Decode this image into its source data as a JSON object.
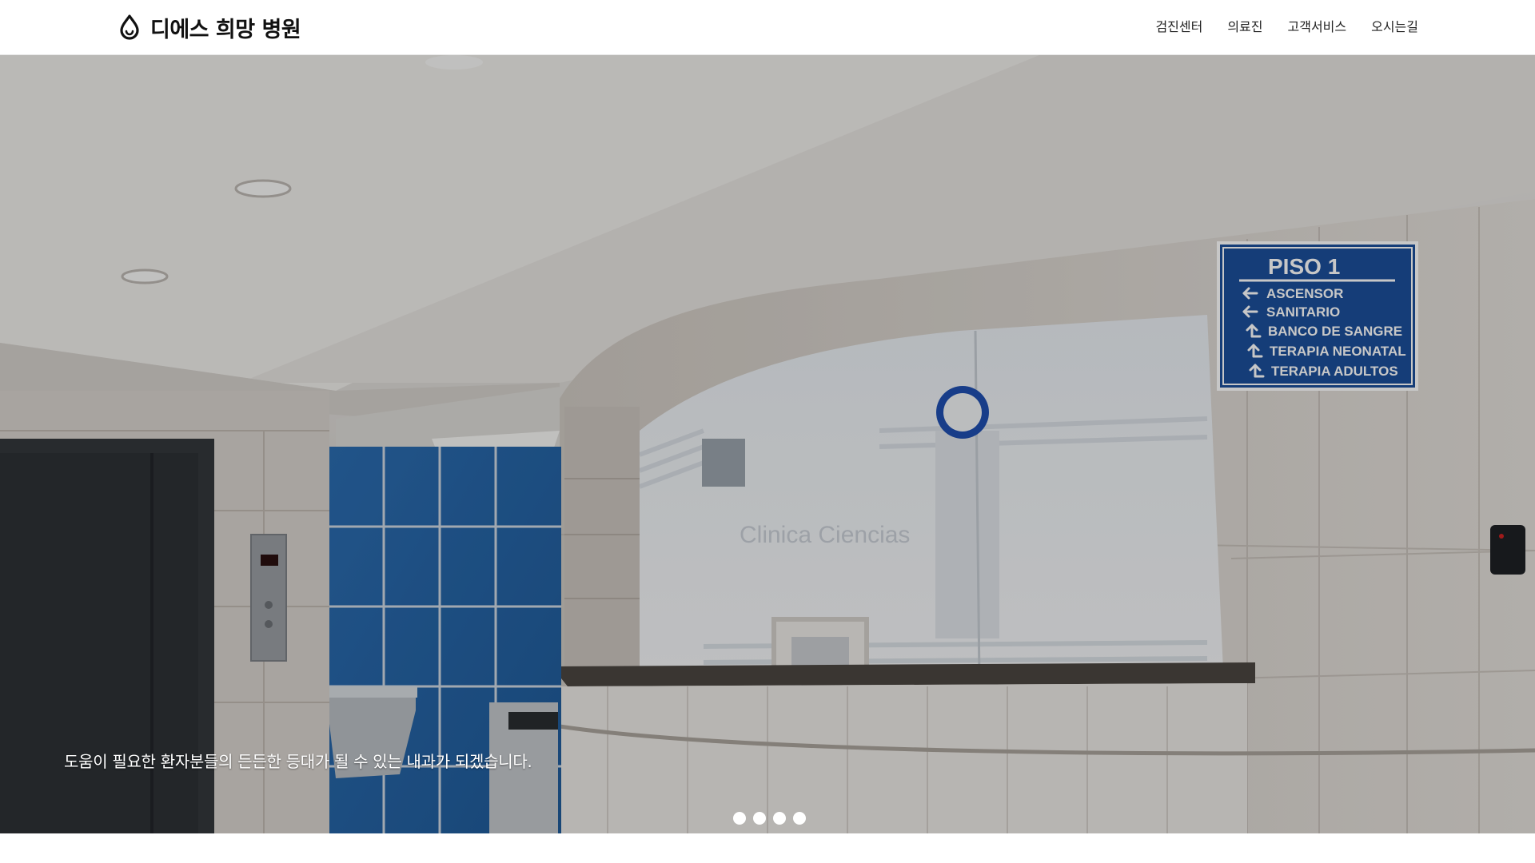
{
  "header": {
    "logo_icon": "water-drop-icon",
    "logo_text": "디에스 희망 병원",
    "nav": [
      {
        "label": "검진센터"
      },
      {
        "label": "의료진"
      },
      {
        "label": "고객서비스"
      },
      {
        "label": "오시는길"
      }
    ]
  },
  "hero": {
    "caption": "도움이 필요한 환자분들의 든든한 등대가 될 수 있는 내과가 되겠습니다.",
    "slide_count": 4,
    "active_slide": 1,
    "sign": {
      "title": "PISO 1",
      "lines": [
        "ASCENSOR",
        "SANITARIO",
        "BANCO DE SANGRE",
        "TERAPIA NEONATAL",
        "TERAPIA ADULTOS"
      ],
      "arrows": [
        "left-arrow-icon",
        "left-arrow-icon",
        "up-arrow-icon",
        "up-arrow-icon",
        "up-arrow-icon"
      ]
    },
    "window_lettering": "Clinica Ciencias"
  },
  "colors": {
    "sign_blue": "#1b4f9a",
    "tile_blue": "#2f6fb0",
    "header_bg": "#ffffff",
    "caption_text": "#ffffff"
  }
}
